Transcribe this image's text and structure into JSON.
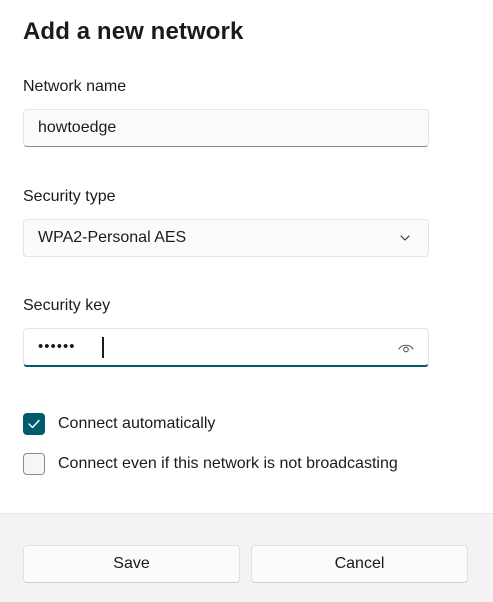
{
  "dialog": {
    "title": "Add a new network"
  },
  "network_name": {
    "label": "Network name",
    "value": "howtoedge"
  },
  "security_type": {
    "label": "Security type",
    "selected": "WPA2-Personal AES",
    "icon": "chevron-down-icon"
  },
  "security_key": {
    "label": "Security key",
    "masked_value": "••••••",
    "reveal_icon": "eye-icon"
  },
  "options": {
    "connect_automatically": {
      "label": "Connect automatically",
      "checked": true
    },
    "connect_not_broadcasting": {
      "label": "Connect even if this network is not broadcasting",
      "checked": false
    }
  },
  "buttons": {
    "save": "Save",
    "cancel": "Cancel"
  },
  "colors": {
    "accent": "#005c6b",
    "footer_bg": "#f3f3f3",
    "dialog_bg": "#ffffff"
  }
}
